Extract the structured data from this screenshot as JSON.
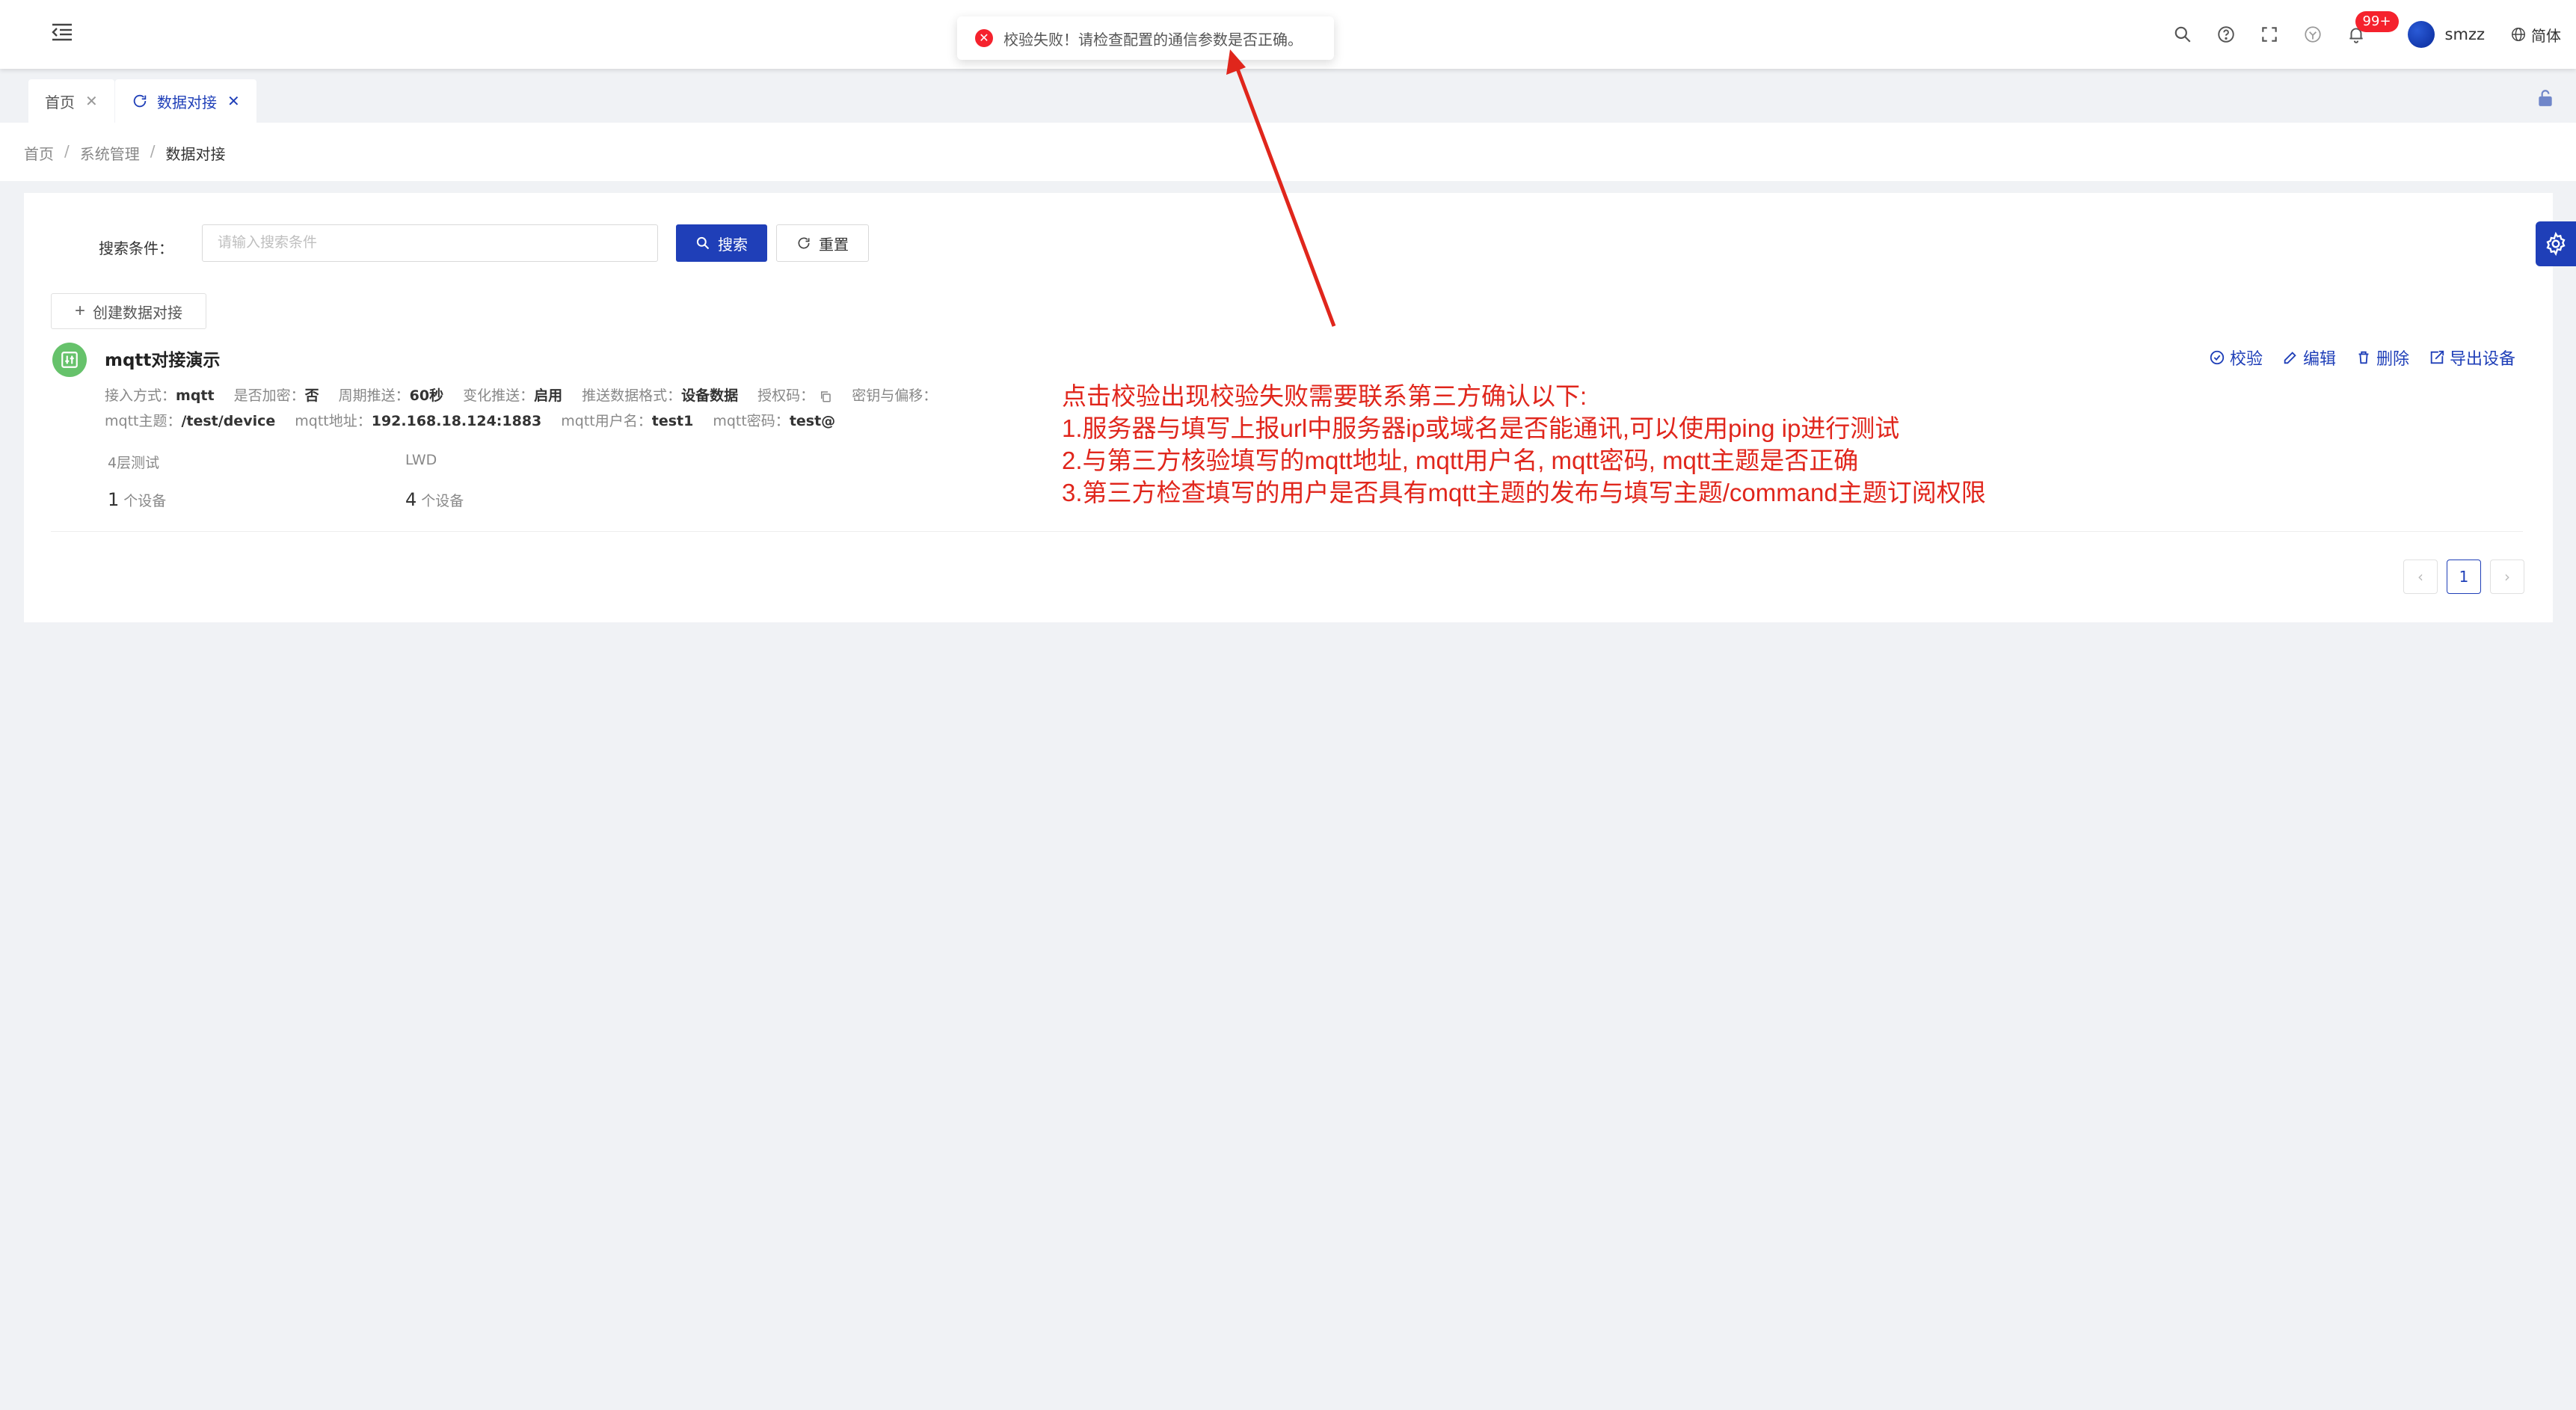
{
  "header": {
    "notification_badge": "99+",
    "username": "smzz",
    "language": "简体"
  },
  "toast": {
    "message": "校验失败！请检查配置的通信参数是否正确。"
  },
  "tabs": [
    {
      "label": "首页"
    },
    {
      "label": "数据对接"
    }
  ],
  "breadcrumb": {
    "items": [
      "首页",
      "系统管理",
      "数据对接"
    ],
    "separator": "/"
  },
  "search": {
    "label": "搜索条件：",
    "placeholder": "请输入搜索条件",
    "search_button": "搜索",
    "reset_button": "重置",
    "create_button": "创建数据对接"
  },
  "item": {
    "title": "mqtt对接演示",
    "actions": {
      "verify": "校验",
      "edit": "编辑",
      "delete": "删除",
      "export": "导出设备"
    },
    "row1": [
      {
        "label": "接入方式：",
        "value": "mqtt"
      },
      {
        "label": "是否加密：",
        "value": "否"
      },
      {
        "label": "周期推送：",
        "value": "60秒"
      },
      {
        "label": "变化推送：",
        "value": "启用"
      },
      {
        "label": "推送数据格式：",
        "value": "设备数据"
      },
      {
        "label": "授权码：",
        "value": ""
      },
      {
        "label": "密钥与偏移：",
        "value": ""
      }
    ],
    "row2": [
      {
        "label": "mqtt主题：",
        "value": "/test/device"
      },
      {
        "label": "mqtt地址：",
        "value": "192.168.18.124:1883"
      },
      {
        "label": "mqtt用户名：",
        "value": "test1"
      },
      {
        "label": "mqtt密码：",
        "value": "test@"
      }
    ],
    "devices": [
      {
        "name": "4层测试",
        "count": "1",
        "unit": "个设备"
      },
      {
        "name": "LWD",
        "count": "4",
        "unit": "个设备"
      }
    ]
  },
  "pagination": {
    "current": "1"
  },
  "annotation": {
    "lines": [
      "点击校验出现校验失败需要联系第三方确认以下:",
      "1.服务器与填写上报url中服务器ip或域名是否能通讯,可以使用ping ip进行测试",
      "2.与第三方核验填写的mqtt地址, mqtt用户名, mqtt密码, mqtt主题是否正确",
      "3.第三方检查填写的用户是否具有mqtt主题的发布与填写主题/command主题订阅权限"
    ],
    "color": "#e0261c"
  },
  "colors": {
    "primary": "#1f3fb8",
    "error": "#f5222d",
    "success_icon": "#66c26b"
  }
}
